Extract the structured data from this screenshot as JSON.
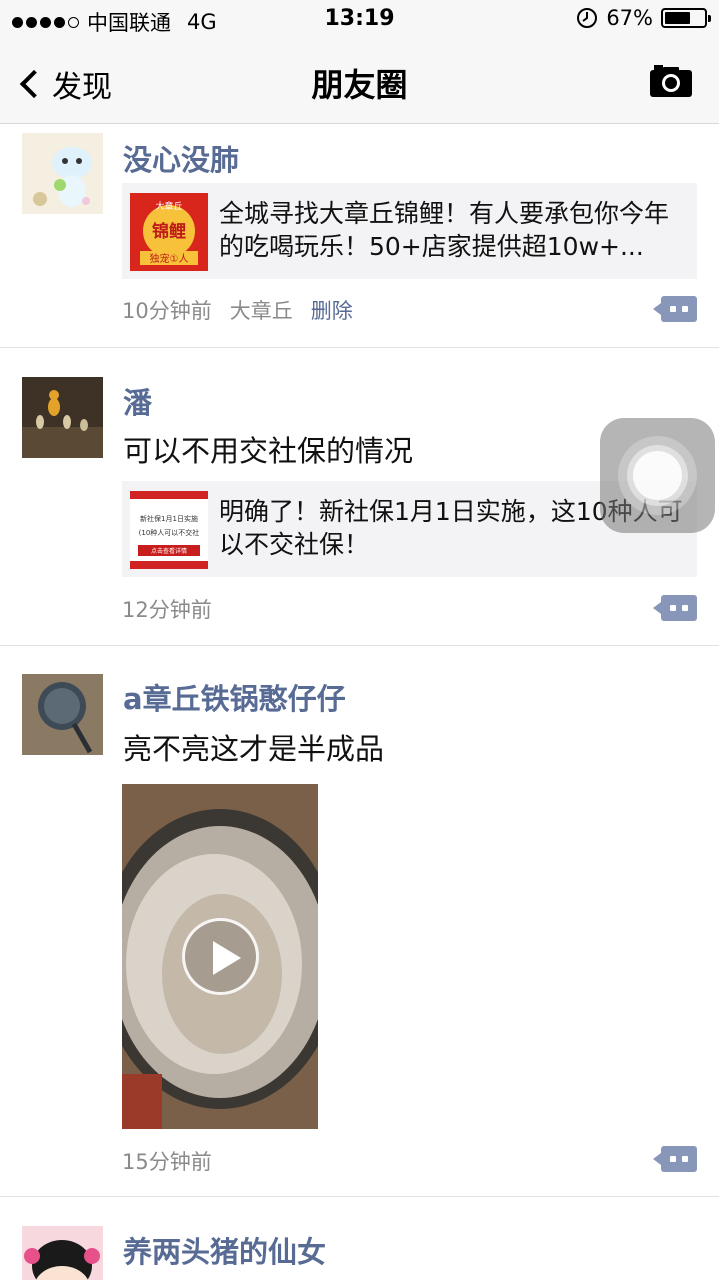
{
  "status_bar": {
    "carrier": "中国联通",
    "network": "4G",
    "time": "13:19",
    "battery_percent": "67%",
    "battery_level": 0.67
  },
  "nav": {
    "back_label": "发现",
    "title": "朋友圈"
  },
  "posts": [
    {
      "nickname": "没心没肺",
      "link_title": "全城寻找大章丘锦鲤！有人要承包你今年的吃喝玩乐！50+店家提供超10w+...",
      "thumb_badge": "大章丘",
      "thumb_main": "锦鲤",
      "thumb_bottom": "独宠①人",
      "time": "10分钟前",
      "location": "大章丘",
      "delete_label": "删除"
    },
    {
      "nickname": "潘",
      "text": "可以不用交社保的情况",
      "link_title": "明确了！新社保1月1日实施，这10种人可以不交社保！",
      "thumb_line1": "新社保1月1日实施",
      "thumb_line2": "(10种人可以不交社",
      "thumb_btn": "点击查看详情",
      "time": "12分钟前"
    },
    {
      "nickname": "a章丘铁锅憨仔仔",
      "text": "亮不亮这才是半成品",
      "time": "15分钟前"
    },
    {
      "nickname": "养两头猪的仙女"
    }
  ],
  "colors": {
    "nickname": "#576b95",
    "comment_button": "#8897b9",
    "nav_background": "#f7f7f7"
  },
  "icons": [
    "chevron-left-icon",
    "camera-icon",
    "comment-icon",
    "play-icon",
    "assistive-touch-icon",
    "alarm-lock-icon",
    "battery-icon",
    "signal-icon"
  ]
}
